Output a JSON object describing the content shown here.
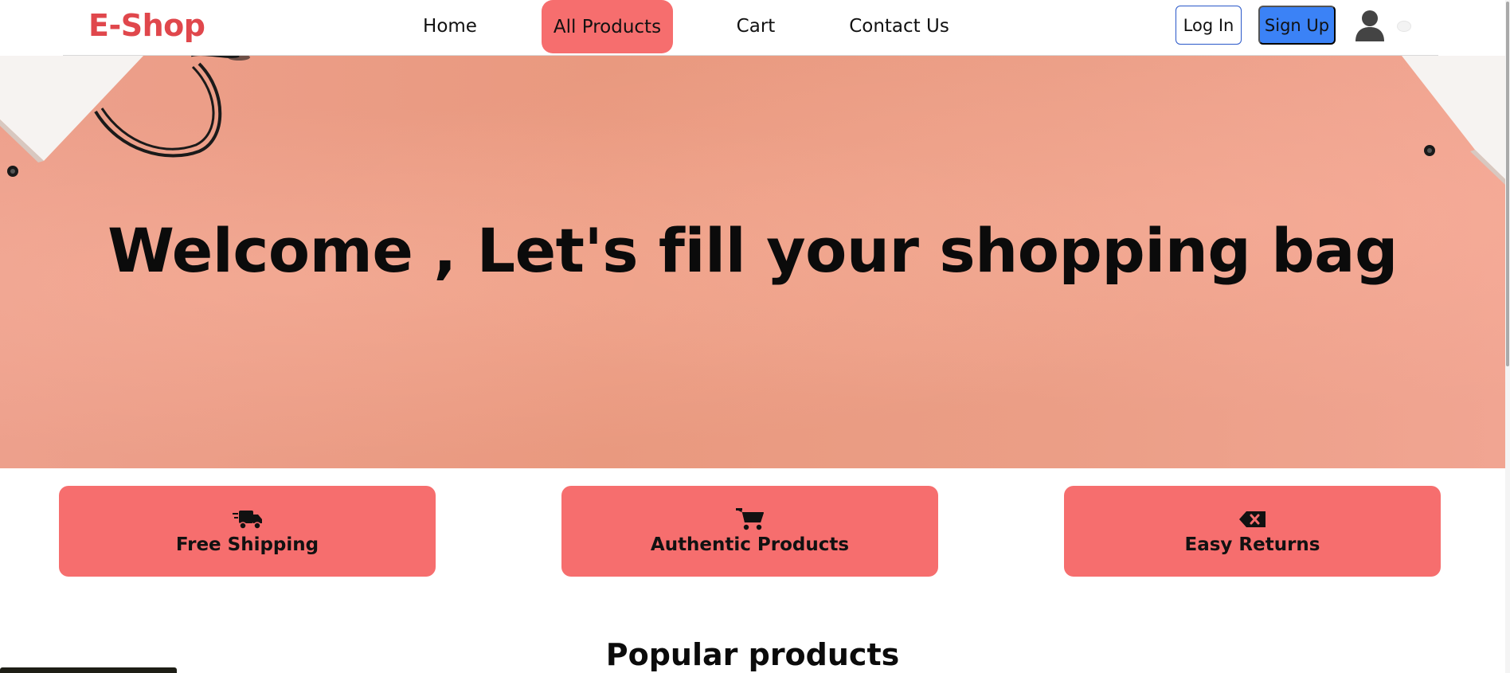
{
  "navbar": {
    "brand": "E-Shop",
    "links": [
      "Home",
      "All Products",
      "Cart",
      "Contact Us"
    ],
    "active_link": "All Products",
    "login_label": "Log In",
    "signup_label": "Sign Up",
    "user_icon": "user-icon",
    "active_color": "#f66e6e",
    "brand_color": "#e0474c",
    "signup_color": "#3b82f6"
  },
  "hero": {
    "title": "Welcome , Let's fill your shopping bag"
  },
  "features": [
    {
      "label": "Free Shipping",
      "icon": "truck-icon"
    },
    {
      "label": "Authentic Products",
      "icon": "cart-icon"
    },
    {
      "label": "Easy Returns",
      "icon": "backspace-icon"
    }
  ],
  "popular": {
    "title": "Popular products"
  }
}
